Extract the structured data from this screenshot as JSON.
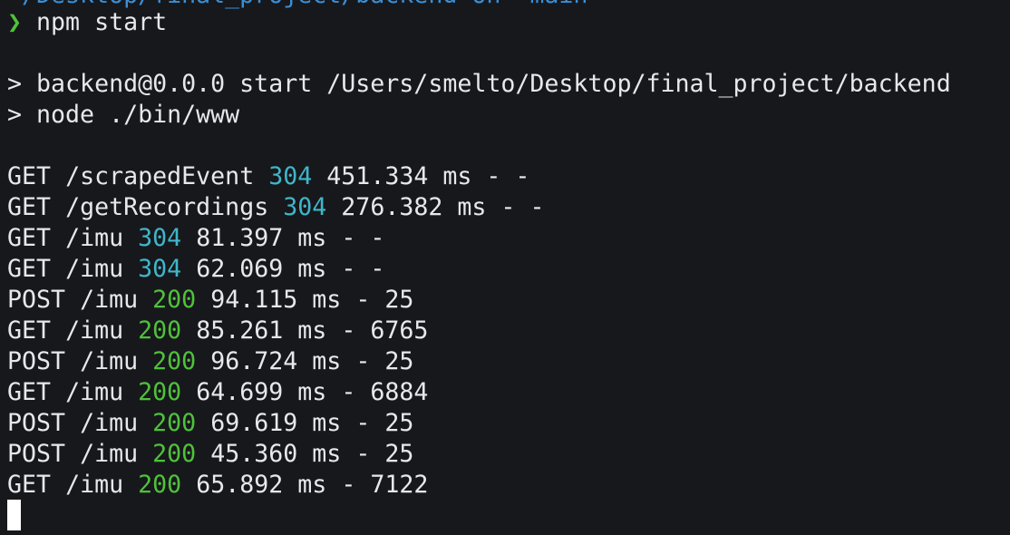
{
  "terminal": {
    "clipped_path": "~/Desktop/final_project/backend on  main",
    "prompt_symbol": "❯",
    "command": "npm start",
    "npm_header": [
      "> backend@0.0.0 start /Users/smelto/Desktop/final_project/backend",
      "> node ./bin/www"
    ],
    "log": [
      {
        "method": "GET",
        "path": "/scrapedEvent",
        "status": "304",
        "time": "451.334 ms",
        "size": "- -"
      },
      {
        "method": "GET",
        "path": "/getRecordings",
        "status": "304",
        "time": "276.382 ms",
        "size": "- -"
      },
      {
        "method": "GET",
        "path": "/imu",
        "status": "304",
        "time": "81.397 ms",
        "size": "- -"
      },
      {
        "method": "GET",
        "path": "/imu",
        "status": "304",
        "time": "62.069 ms",
        "size": "- -"
      },
      {
        "method": "POST",
        "path": "/imu",
        "status": "200",
        "time": "94.115 ms",
        "size": "- 25"
      },
      {
        "method": "GET",
        "path": "/imu",
        "status": "200",
        "time": "85.261 ms",
        "size": "- 6765"
      },
      {
        "method": "POST",
        "path": "/imu",
        "status": "200",
        "time": "96.724 ms",
        "size": "- 25"
      },
      {
        "method": "GET",
        "path": "/imu",
        "status": "200",
        "time": "64.699 ms",
        "size": "- 6884"
      },
      {
        "method": "POST",
        "path": "/imu",
        "status": "200",
        "time": "69.619 ms",
        "size": "- 25"
      },
      {
        "method": "POST",
        "path": "/imu",
        "status": "200",
        "time": "45.360 ms",
        "size": "- 25"
      },
      {
        "method": "GET",
        "path": "/imu",
        "status": "200",
        "time": "65.892 ms",
        "size": "- 7122"
      }
    ]
  },
  "colors": {
    "background": "#17181c",
    "text": "#e8e8ea",
    "prompt_arrow": "#4fc23a",
    "status_304": "#3fb6c9",
    "status_200": "#4fc23a",
    "path_blue": "#3a8fd6"
  }
}
